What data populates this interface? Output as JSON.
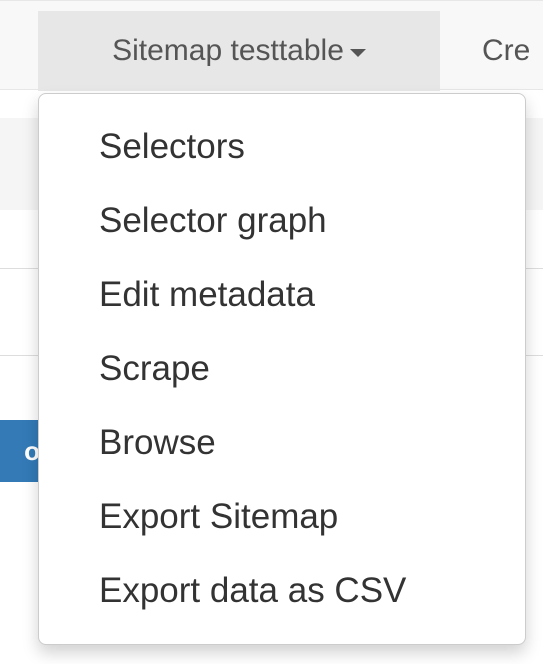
{
  "navbar": {
    "active_item": {
      "label": "Sitemap testtable",
      "caret_icon": "caret-down-icon"
    },
    "next_item": {
      "label": "Cre"
    }
  },
  "background": {
    "button_fragment": "o"
  },
  "dropdown": {
    "items": [
      {
        "label": "Selectors"
      },
      {
        "label": "Selector graph"
      },
      {
        "label": "Edit metadata"
      },
      {
        "label": "Scrape"
      },
      {
        "label": "Browse"
      },
      {
        "label": "Export Sitemap"
      },
      {
        "label": "Export data as CSV"
      }
    ]
  },
  "colors": {
    "navbar_bg": "#f8f8f8",
    "active_item_bg": "#e7e7e7",
    "nav_text": "#555555",
    "menu_text": "#333333",
    "primary_button": "#337ab7"
  }
}
